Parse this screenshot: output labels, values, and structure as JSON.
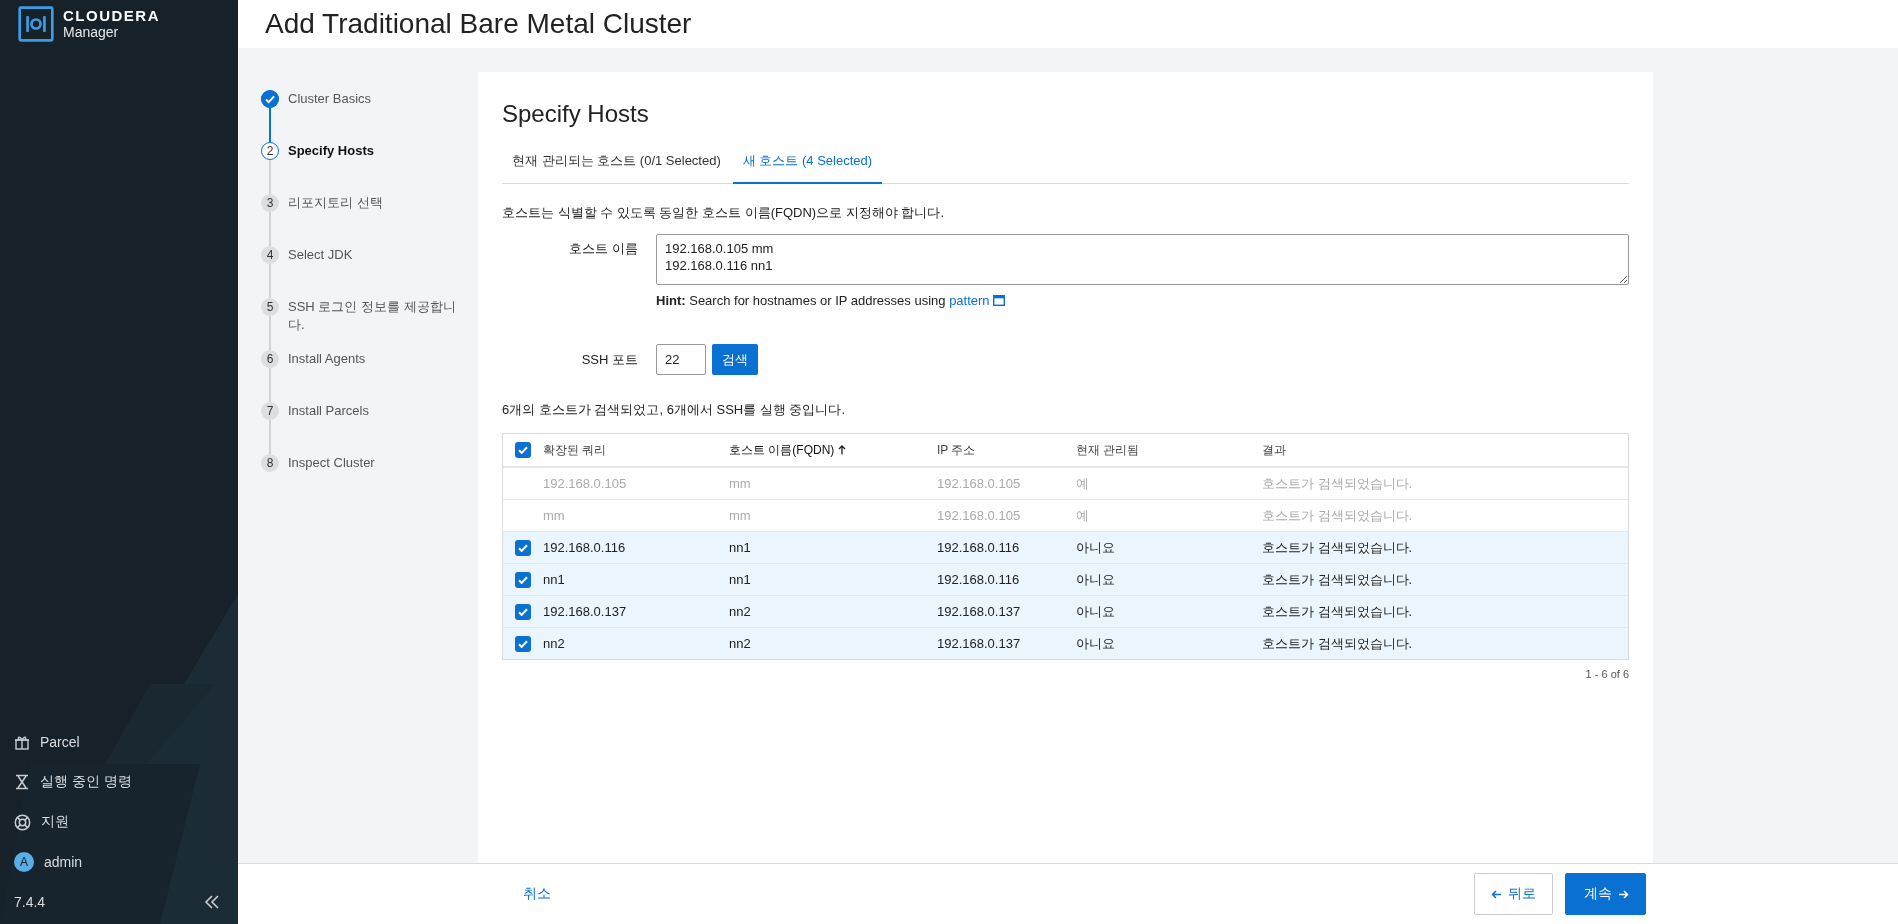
{
  "app": {
    "brand": "CLOUDERA",
    "product": "Manager",
    "version": "7.4.4"
  },
  "sidebar": {
    "items": [
      {
        "kind": "parcel",
        "label": "Parcel"
      },
      {
        "kind": "commands",
        "label": "실행 중인 명령"
      },
      {
        "kind": "support",
        "label": "지원"
      },
      {
        "kind": "user",
        "label": "admin",
        "avatar": "A"
      }
    ]
  },
  "page_title": "Add Traditional Bare Metal Cluster",
  "steps": [
    {
      "label": "Cluster Basics",
      "done": true,
      "current": false
    },
    {
      "number": "2",
      "label": "Specify Hosts",
      "done": false,
      "current": true
    },
    {
      "number": "3",
      "label": "리포지토리 선택",
      "done": false,
      "current": false
    },
    {
      "number": "4",
      "label": "Select JDK",
      "done": false,
      "current": false
    },
    {
      "number": "5",
      "label": "SSH 로그인 정보를 제공합니다.",
      "done": false,
      "current": false
    },
    {
      "number": "6",
      "label": "Install Agents",
      "done": false,
      "current": false
    },
    {
      "number": "7",
      "label": "Install Parcels",
      "done": false,
      "current": false
    },
    {
      "number": "8",
      "label": "Inspect Cluster",
      "done": false,
      "current": false
    }
  ],
  "panel": {
    "title": "Specify Hosts",
    "tabs": [
      {
        "label": "현재 관리되는 호스트 (0/1 Selected)",
        "selected": false
      },
      {
        "label": "새 호스트 (4 Selected)",
        "selected": true
      }
    ],
    "instruction": "호스트는 식별할 수 있도록 동일한 호스트 이름(FQDN)으로 지정해야 합니다.",
    "hostname_label": "호스트 이름",
    "hostnames": "192.168.0.105 mm\n192.168.0.116 nn1",
    "hint": "**Hint:** Search for hostnames or IP addresses using",
    "hint_link": "pattern",
    "ssh_label": "SSH 포트",
    "ssh_port": "22",
    "search_button": "검색",
    "result_summary": "6개의 호스트가 검색되었고, 6개에서 SSH를 실행 중입니다."
  },
  "table": {
    "select_all_checked": true,
    "columns": [
      {
        "label": "확장된 쿼리"
      },
      {
        "label": "호스트 이름(FQDN)",
        "sorted": true
      },
      {
        "label": "IP 주소"
      },
      {
        "label": "현재 관리됨"
      },
      {
        "label": "결과"
      }
    ],
    "rows": [
      {
        "disabled": true,
        "checked": false,
        "cells": [
          "192.168.0.105",
          "mm",
          "192.168.0.105",
          "예",
          "호스트가 검색되었습니다."
        ]
      },
      {
        "disabled": true,
        "checked": false,
        "cells": [
          "mm",
          "mm",
          "192.168.0.105",
          "예",
          "호스트가 검색되었습니다."
        ]
      },
      {
        "disabled": false,
        "checked": true,
        "cells": [
          "192.168.0.116",
          "nn1",
          "192.168.0.116",
          "아니요",
          "호스트가 검색되었습니다."
        ]
      },
      {
        "disabled": false,
        "checked": true,
        "cells": [
          "nn1",
          "nn1",
          "192.168.0.116",
          "아니요",
          "호스트가 검색되었습니다."
        ]
      },
      {
        "disabled": false,
        "checked": true,
        "cells": [
          "192.168.0.137",
          "nn2",
          "192.168.0.137",
          "아니요",
          "호스트가 검색되었습니다."
        ]
      },
      {
        "disabled": false,
        "checked": true,
        "cells": [
          "nn2",
          "nn2",
          "192.168.0.137",
          "아니요",
          "호스트가 검색되었습니다."
        ]
      }
    ],
    "pagination": "1 - 6 of 6"
  },
  "footer": {
    "cancel": "취소",
    "back": "뒤로",
    "continue": "계속"
  }
}
